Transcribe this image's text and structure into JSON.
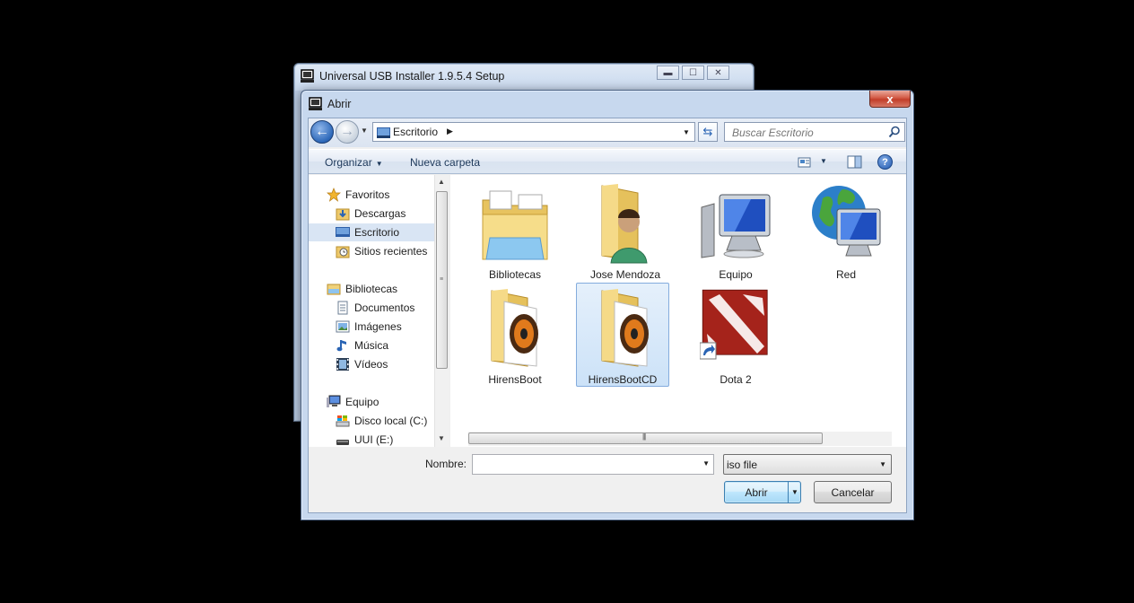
{
  "background_window": {
    "title": "Universal USB Installer 1.9.5.4 Setup"
  },
  "dialog": {
    "title": "Abrir",
    "close_label": "x",
    "address": {
      "location": "Escritorio"
    },
    "search": {
      "placeholder": "Buscar Escritorio"
    },
    "toolbar": {
      "organize_label": "Organizar",
      "new_folder_label": "Nueva carpeta",
      "help_label": "?"
    },
    "nav_pane": {
      "favorites_header": "Favoritos",
      "favorites": [
        "Descargas",
        "Escritorio",
        "Sitios recientes"
      ],
      "libraries_header": "Bibliotecas",
      "libraries": [
        "Documentos",
        "Imágenes",
        "Música",
        "Vídeos"
      ],
      "computer_header": "Equipo",
      "drives": [
        "Disco local (C:)",
        "UUI (E:)"
      ]
    },
    "files": [
      "Bibliotecas",
      "Jose Mendoza",
      "Equipo",
      "Red",
      "HirensBoot",
      "HirensBootCD",
      "Dota 2"
    ],
    "selected_file": "HirensBootCD",
    "filename": {
      "label": "Nombre:",
      "value": ""
    },
    "filetype": {
      "selected": "iso file"
    },
    "buttons": {
      "open_label": "Abrir",
      "cancel_label": "Cancelar"
    }
  }
}
